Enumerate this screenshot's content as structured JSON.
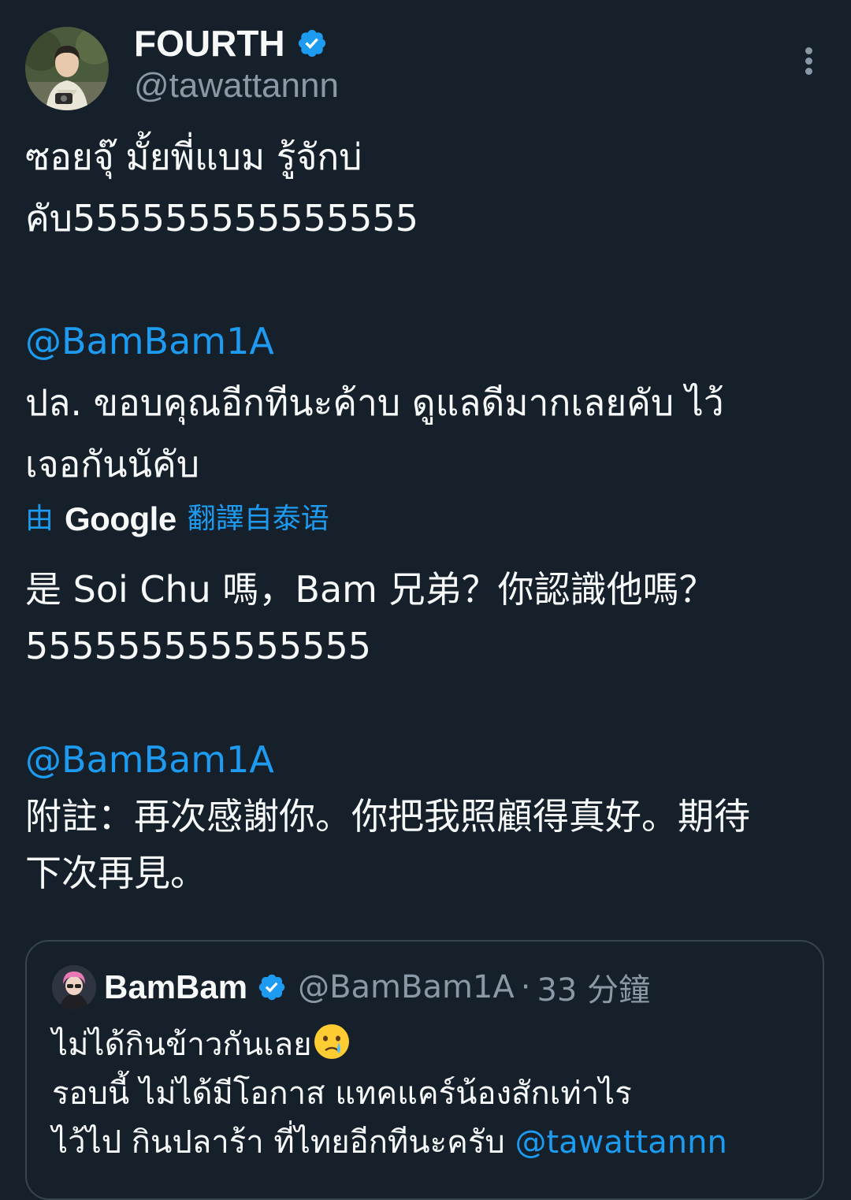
{
  "tweet": {
    "author": {
      "display_name": "FOURTH",
      "handle": "@tawattannn",
      "verified": true,
      "avatar_icon": "profile-photo"
    },
    "more_icon": "more-vertical-icon",
    "text": {
      "line1": "ซอยจุ๊ มั้ยพี่แบม รู้จักบ่",
      "line2": "คับ555555555555555",
      "mention1": "@BamBam1A",
      "ps_line": "ปล. ขอบคุณอีกทีนะค้าบ ดูแลดีมากเลยคับ ไว้",
      "ps_line2": "เจอกันนัคับ"
    },
    "translation": {
      "by_label": "由",
      "provider": "Google",
      "from_label": "翻譯自泰语",
      "line1": "是 Soi Chu 嗎，Bam 兄弟？你認識他嗎？",
      "line2": "555555555555555",
      "mention": "@BamBam1A",
      "ps_line1": "附註：再次感謝你。你把我照顧得真好。期待",
      "ps_line2": "下次再見。"
    }
  },
  "quoted_tweet": {
    "display_name": "BamBam",
    "verified": true,
    "handle": "@BamBam1A",
    "separator": "·",
    "time": "33 分鐘",
    "line1": "ไม่ได้กินข้าวกันเลย",
    "line1_emoji": "crying-face-emoji",
    "line2": "รอบนี้ ไม่ได้มีโอกาส แทคแคร์น้องสักเท่าไร",
    "line3_text": "ไว้ไป กินปลาร้า ที่ไทยอีกทีนะครับ ",
    "line3_mention": "@tawattannn"
  },
  "colors": {
    "background": "#15202b",
    "text": "#f7f9f9",
    "secondary": "#8b98a5",
    "accent": "#1d9bf0",
    "border": "#38444d"
  }
}
